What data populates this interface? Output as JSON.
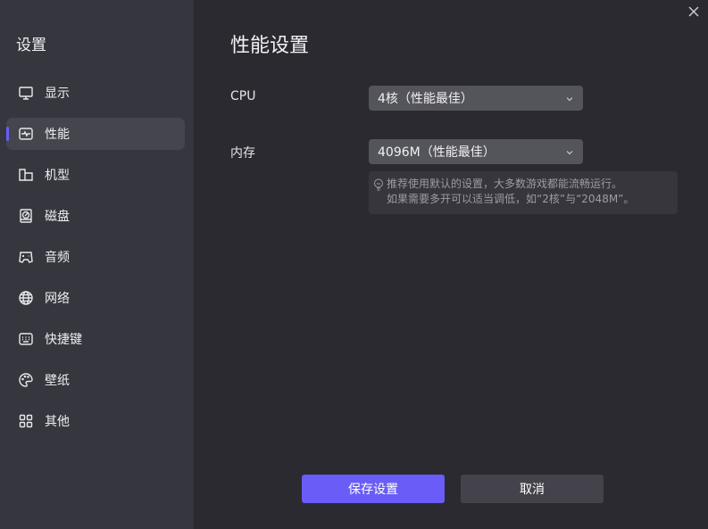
{
  "sidebar": {
    "title": "设置",
    "items": [
      {
        "label": "显示",
        "icon": "monitor-icon"
      },
      {
        "label": "性能",
        "icon": "performance-icon",
        "active": true
      },
      {
        "label": "机型",
        "icon": "folder-icon"
      },
      {
        "label": "磁盘",
        "icon": "disk-icon"
      },
      {
        "label": "音频",
        "icon": "gamepad-icon"
      },
      {
        "label": "网络",
        "icon": "globe-icon"
      },
      {
        "label": "快捷键",
        "icon": "keyboard-icon"
      },
      {
        "label": "壁纸",
        "icon": "palette-icon"
      },
      {
        "label": "其他",
        "icon": "grid-icon"
      }
    ]
  },
  "main": {
    "title": "性能设置",
    "cpu": {
      "label": "CPU",
      "value": "4核（性能最佳）"
    },
    "memory": {
      "label": "内存",
      "value": "4096M（性能最佳）"
    },
    "hint": {
      "line1": "推荐使用默认的设置，大多数游戏都能流畅运行。",
      "line2": "如果需要多开可以适当调低，如“2核”与“2048M”。"
    }
  },
  "buttons": {
    "save": "保存设置",
    "cancel": "取消"
  },
  "colors": {
    "accent": "#6a5cf6",
    "sidebar": "#36373e",
    "background": "#2b2a30"
  }
}
